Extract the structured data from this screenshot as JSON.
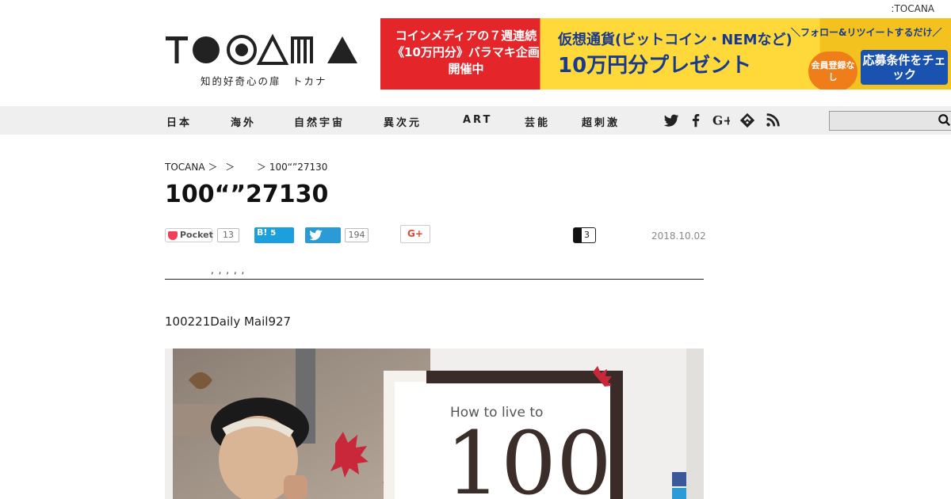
{
  "site": {
    "top_right": ":TOCANA",
    "logo_text": "TOCANA",
    "tagline": "知的好奇心の扉　トカナ"
  },
  "banner": {
    "left_text": "コインメディアの７週連続《10万円分》バラマキ企画開催中",
    "main_text_1": "仮想通貨(ビットコイン・NEMなど)",
    "main_text_2": "10万円分プレゼント",
    "top_right_text": "＼フォロー&リツイートするだけ／",
    "badge_text": "会員登録なし",
    "cta_text": "応募条件をチェック"
  },
  "nav": {
    "items": [
      "日本",
      "海外",
      "自然宇宙",
      "異次元",
      "ART",
      "芸能",
      "超刺激"
    ],
    "social_icons": [
      "twitter-icon",
      "facebook-icon",
      "google-plus-icon",
      "feedly-icon",
      "rss-icon"
    ],
    "search_placeholder": ""
  },
  "article": {
    "breadcrumb": [
      "TOCANA ＞",
      "＞",
      "＞ 100“”27130"
    ],
    "title": "100“”27130",
    "share": {
      "pocket_label": "Pocket",
      "pocket_count": "13",
      "hatena_label": "B!",
      "hatena_count": "5",
      "twitter_count": "194",
      "gplus_label": "G+",
      "comment_count": "3"
    },
    "date": "2018.10.02",
    "tags": ", , , , ,",
    "lead": "100221Daily Mail927",
    "image": {
      "caption_small": "How to live to",
      "caption_big": "100"
    }
  },
  "colors": {
    "nav_bg": "#efefef",
    "hatena": "#1ba0dd",
    "twitter": "#2b9bd8",
    "pocket": "#ee4056",
    "banner_red": "#e4252a",
    "banner_yellow": "#ffd83a"
  }
}
